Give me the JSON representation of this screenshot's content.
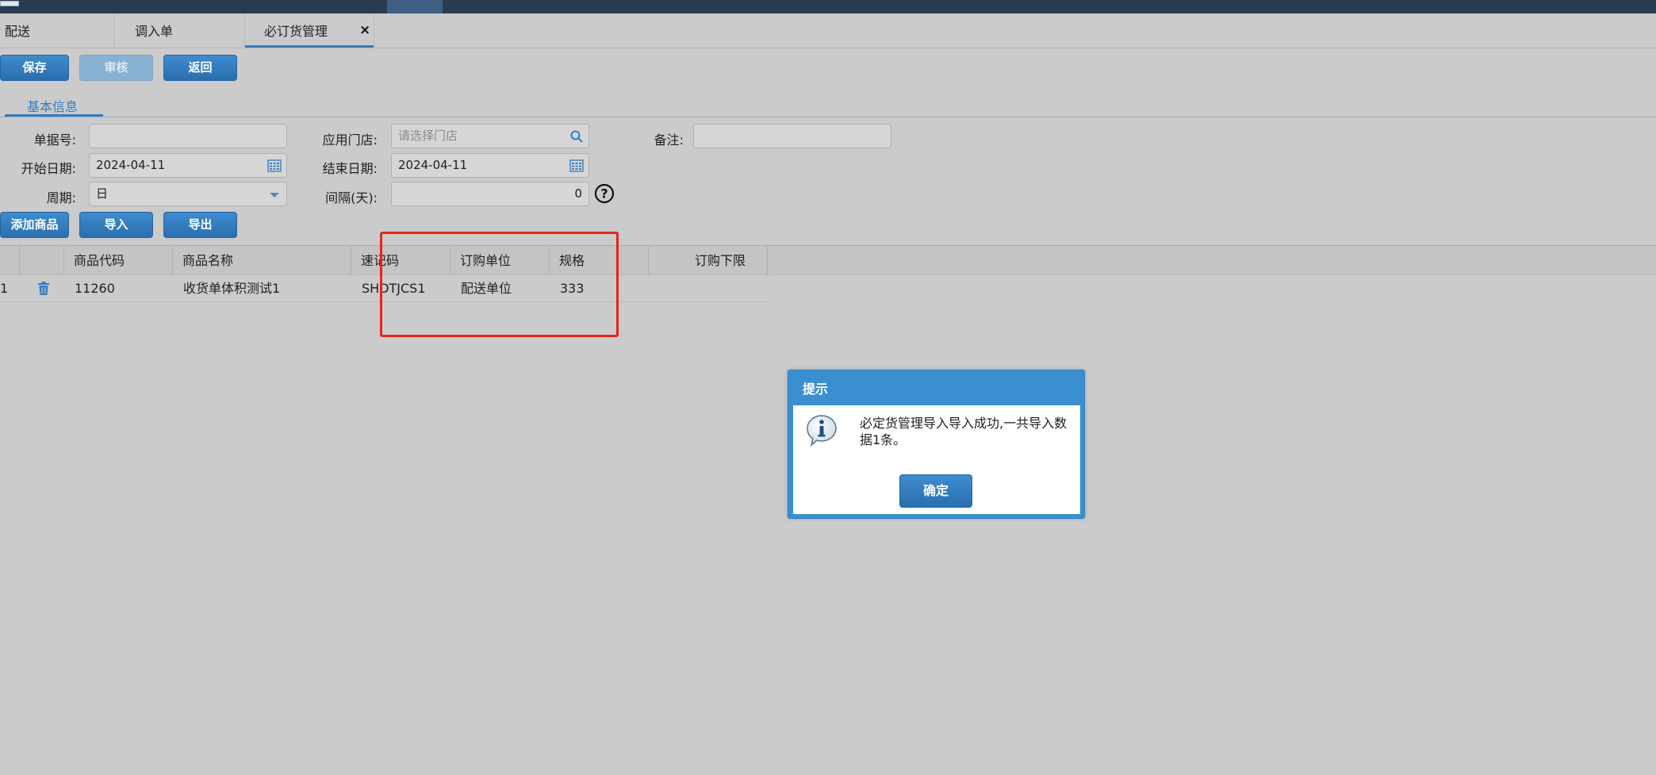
{
  "tabs": [
    {
      "label": "配送"
    },
    {
      "label": "调入单"
    },
    {
      "label": "必订货管理"
    }
  ],
  "tab_close": "×",
  "toolbar": {
    "save": "保存",
    "audit": "审核",
    "back": "返回"
  },
  "section": "基本信息",
  "form": {
    "doc_no_label": "单据号:",
    "doc_no_value": "",
    "store_label": "应用门店:",
    "store_placeholder": "请选择门店",
    "remark_label": "备注:",
    "remark_value": "",
    "start_label": "开始日期:",
    "start_value": "2024-04-11",
    "end_label": "结束日期:",
    "end_value": "2024-04-11",
    "cycle_label": "周期:",
    "cycle_value": "日",
    "interval_label": "间隔(天):",
    "interval_value": "0",
    "help_glyph": "?"
  },
  "actions": {
    "add": "添加商品",
    "import": "导入",
    "export": "导出"
  },
  "grid": {
    "headers": [
      "商品代码",
      "商品名称",
      "速记码",
      "订购单位",
      "规格",
      "订购下限"
    ],
    "rows": [
      {
        "index": "1",
        "code": "11260",
        "name": "收货单体积测试1",
        "shorthand": "SHDTJCS1",
        "unit": "配送单位",
        "spec": "333",
        "min": ""
      }
    ]
  },
  "dialog": {
    "title": "提示",
    "message": "必定货管理导入导入成功,一共导入数据1条。",
    "ok": "确定"
  },
  "colors": {
    "accent": "#2f7fc4",
    "highlight": "#e8241a",
    "topbar": "#2a3b4f"
  }
}
